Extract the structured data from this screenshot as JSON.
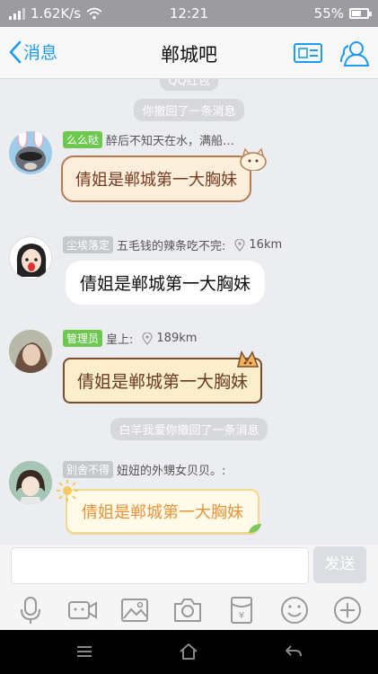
{
  "status_bar": {
    "speed": "1.62K/s",
    "time": "12:21",
    "battery": "55%",
    "battery_level": 0.55
  },
  "nav": {
    "back_label": "消息",
    "title": "郸城吧"
  },
  "chat": {
    "top_partial": "QQ红包",
    "recall_notice_1": "你撤回了一条消息",
    "recall_notice_2": "白羊我爱你撤回了一条消息",
    "messages": [
      {
        "tag": "么么哒",
        "name": "醉后不知天在水，满船…",
        "distance": "",
        "text": "倩姐是郸城第一大胸妹",
        "bubble_style": "scroll"
      },
      {
        "tag": "尘埃落定",
        "name": "五毛钱的辣条吃不完:",
        "distance": "16km",
        "text": "倩姐是郸城第一大胸妹",
        "bubble_style": "white"
      },
      {
        "tag": "管理员",
        "name": "皇上:",
        "distance": "189km",
        "text": "倩姐是郸城第一大胸妹",
        "bubble_style": "parchment"
      },
      {
        "tag": "别舍不得",
        "name": "妞妞的外甥女贝贝。:",
        "distance": "",
        "text": "倩姐是郸城第一大胸妹",
        "bubble_style": "star"
      }
    ]
  },
  "input": {
    "send_label": "发送"
  },
  "colors": {
    "accent": "#1e9bf0",
    "tag_green": "#6cc84f",
    "tag_gray": "#c5c9ce"
  }
}
